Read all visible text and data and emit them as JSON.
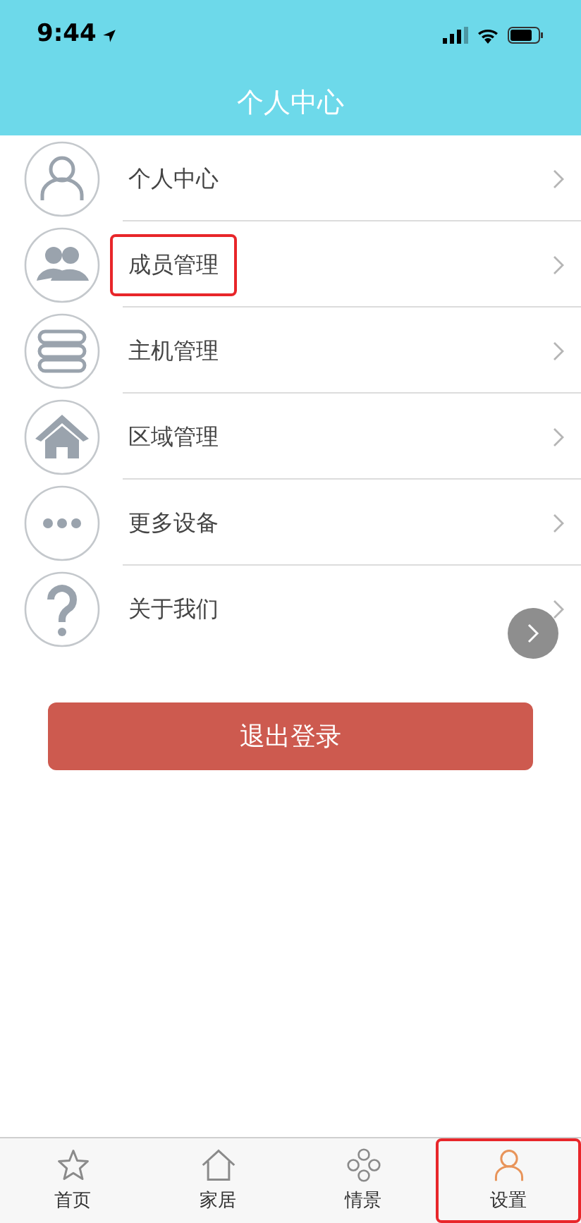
{
  "status_bar": {
    "time": "9:44"
  },
  "header": {
    "title": "个人中心"
  },
  "menu": [
    {
      "kind": "person",
      "label": "个人中心",
      "highlighted": false
    },
    {
      "kind": "people",
      "label": "成员管理",
      "highlighted": true
    },
    {
      "kind": "server",
      "label": "主机管理",
      "highlighted": false
    },
    {
      "kind": "home",
      "label": "区域管理",
      "highlighted": false
    },
    {
      "kind": "more",
      "label": "更多设备",
      "highlighted": false
    },
    {
      "kind": "help",
      "label": "关于我们",
      "highlighted": false
    }
  ],
  "logout_button": "退出登录",
  "tab_bar": [
    {
      "kind": "star",
      "label": "首页",
      "selected": false,
      "highlighted": false
    },
    {
      "kind": "house",
      "label": "家居",
      "selected": false,
      "highlighted": false
    },
    {
      "kind": "scene",
      "label": "情景",
      "selected": false,
      "highlighted": false
    },
    {
      "kind": "person",
      "label": "设置",
      "selected": true,
      "highlighted": true
    }
  ]
}
